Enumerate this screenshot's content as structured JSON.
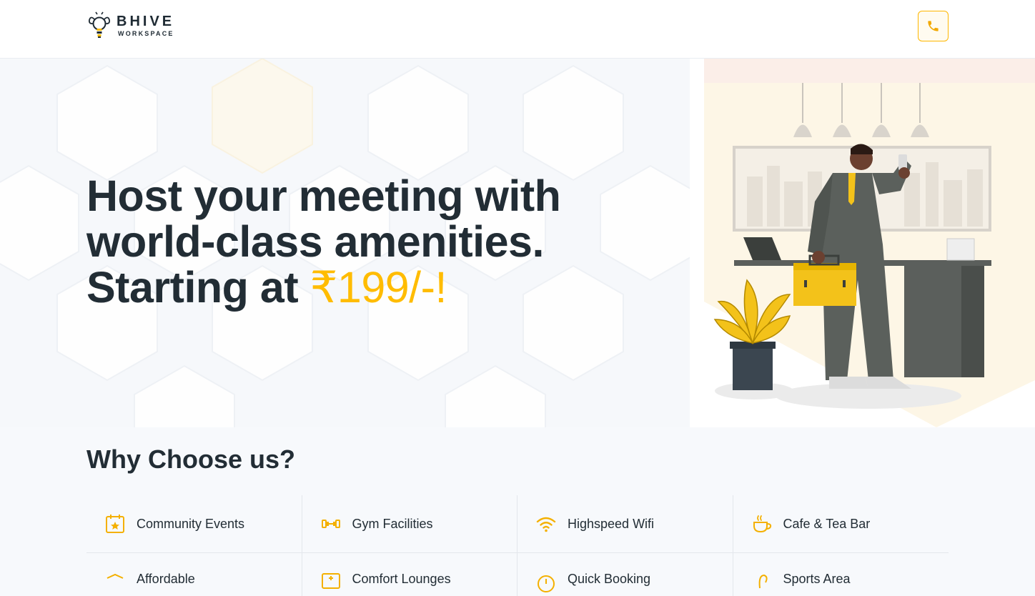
{
  "header": {
    "brand_name": "BHIVE",
    "brand_sub": "WORKSPACE",
    "call_icon": "phone-icon"
  },
  "hero": {
    "title_main": "Host your meeting with world-class amenities. Starting at",
    "title_price": "₹199/-!",
    "accent_color": "#ffbc00"
  },
  "why": {
    "heading": "Why Choose us?",
    "features": [
      {
        "label": "Community Events",
        "icon": "calendar-star-icon"
      },
      {
        "label": "Gym Facilities",
        "icon": "dumbbell-icon"
      },
      {
        "label": "Highspeed Wifi",
        "icon": "wifi-icon"
      },
      {
        "label": "Cafe & Tea Bar",
        "icon": "coffee-cup-icon"
      }
    ],
    "features_row2": [
      {
        "label": "Affordable",
        "icon": "tag-icon"
      },
      {
        "label": "Comfort Lounges",
        "icon": "lounge-icon"
      },
      {
        "label": "Quick Booking",
        "icon": "clock-icon"
      },
      {
        "label": "Sports Area",
        "icon": "sports-icon"
      }
    ]
  }
}
